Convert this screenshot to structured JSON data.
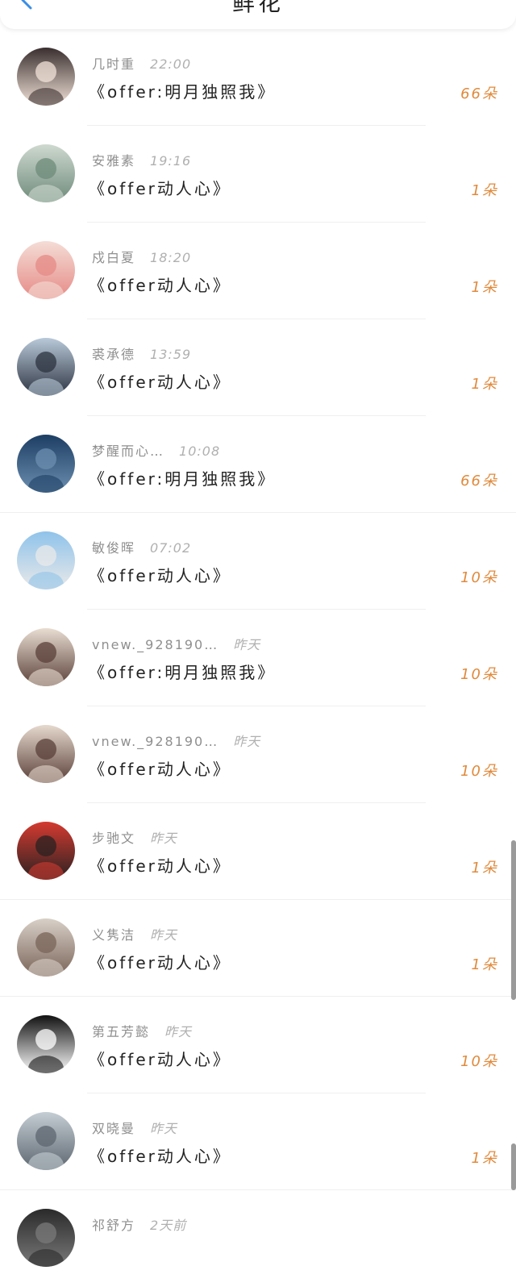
{
  "header": {
    "title": "鲜花"
  },
  "rows": [
    {
      "name": "几时重",
      "time": "22:00",
      "book": "《offer:明月独照我》",
      "count": "66朵",
      "avatar_colors": [
        "#3a2f2f",
        "#f2e3d8"
      ]
    },
    {
      "name": "安雅素",
      "time": "19:16",
      "book": "《offer动人心》",
      "count": "1朵",
      "avatar_colors": [
        "#cfd9d0",
        "#6e8b7a"
      ]
    },
    {
      "name": "戍白夏",
      "time": "18:20",
      "book": "《offer动人心》",
      "count": "1朵",
      "avatar_colors": [
        "#f4ddd6",
        "#e68a86"
      ]
    },
    {
      "name": "裘承德",
      "time": "13:59",
      "book": "《offer动人心》",
      "count": "1朵",
      "avatar_colors": [
        "#b9c9d9",
        "#2c3340"
      ]
    },
    {
      "name": "梦醒而心…",
      "time": "10:08",
      "book": "《offer:明月独照我》",
      "count": "66朵",
      "avatar_colors": [
        "#1d3e63",
        "#6c8fb0"
      ]
    },
    {
      "name": "敏俊晖",
      "time": "07:02",
      "book": "《offer动人心》",
      "count": "10朵",
      "avatar_colors": [
        "#8fc3ea",
        "#e9e9e9"
      ]
    },
    {
      "name": "vnew._928190…",
      "time": "昨天",
      "book": "《offer:明月独照我》",
      "count": "10朵",
      "avatar_colors": [
        "#e9ddd2",
        "#5a4038"
      ]
    },
    {
      "name": "vnew._928190…",
      "time": "昨天",
      "book": "《offer动人心》",
      "count": "10朵",
      "avatar_colors": [
        "#e6d9ce",
        "#5a4038"
      ]
    },
    {
      "name": "步驰文",
      "time": "昨天",
      "book": "《offer动人心》",
      "count": "1朵",
      "avatar_colors": [
        "#d43a30",
        "#2a2222"
      ]
    },
    {
      "name": "义隽洁",
      "time": "昨天",
      "book": "《offer动人心》",
      "count": "1朵",
      "avatar_colors": [
        "#d8d0c8",
        "#7a6458"
      ]
    },
    {
      "name": "第五芳懿",
      "time": "昨天",
      "book": "《offer动人心》",
      "count": "10朵",
      "avatar_colors": [
        "#111111",
        "#ffffff"
      ]
    },
    {
      "name": "双晓曼",
      "time": "昨天",
      "book": "《offer动人心》",
      "count": "1朵",
      "avatar_colors": [
        "#c5ced4",
        "#5d6670"
      ]
    },
    {
      "name": "祁舒方",
      "time": "2天前",
      "book": "",
      "count": "",
      "avatar_colors": [
        "#2a2a2a",
        "#7a7a7a"
      ]
    }
  ]
}
